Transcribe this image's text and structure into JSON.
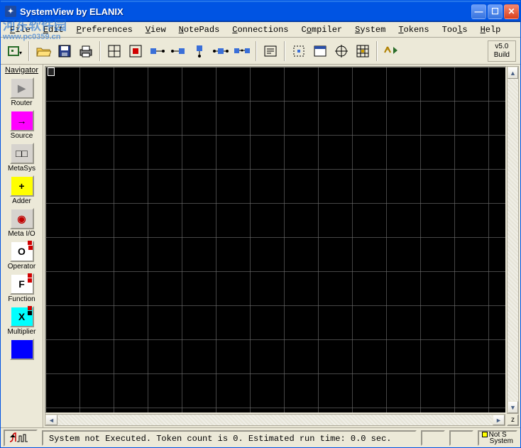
{
  "window": {
    "title": "SystemView by ELANIX"
  },
  "watermark": {
    "text": "河东软件园",
    "url": "www.pc0359.cn"
  },
  "menus": [
    "File",
    "Edit",
    "Preferences",
    "View",
    "NotePads",
    "Connections",
    "Compiler",
    "System",
    "Tokens",
    "Tools",
    "Help"
  ],
  "version": {
    "line1": "v5.0",
    "line2": "Build"
  },
  "navigator": {
    "title": "Navigator",
    "items": [
      {
        "label": "Router",
        "glyph": "▶",
        "bg": "#d6d3ce",
        "fg": "#808080"
      },
      {
        "label": "Source",
        "glyph": "→",
        "bg": "#ff00ff",
        "fg": "#000"
      },
      {
        "label": "MetaSys",
        "glyph": "□□",
        "bg": "#d6d3ce",
        "fg": "#000"
      },
      {
        "label": "Adder",
        "glyph": "+",
        "bg": "#ffff00",
        "fg": "#000"
      },
      {
        "label": "Meta I/O",
        "glyph": "◉",
        "bg": "#d6d3ce",
        "fg": "#c00000"
      },
      {
        "label": "Operator",
        "glyph": "O",
        "bg": "#ffffff",
        "fg": "#000"
      },
      {
        "label": "Function",
        "glyph": "F",
        "bg": "#ffffff",
        "fg": "#000"
      },
      {
        "label": "Multiplier",
        "glyph": "X",
        "bg": "#00ffff",
        "fg": "#000"
      },
      {
        "label": "",
        "glyph": "",
        "bg": "#0000ff",
        "fg": "#fff"
      }
    ]
  },
  "status": {
    "text": "System not Executed.  Token count is 0.   Estimated run time: 0.0 sec.",
    "flag_line1": "Not S",
    "flag_line2": "System"
  },
  "toolbar_icons": [
    "system-menu-icon",
    "open-icon",
    "save-icon",
    "print-icon",
    "grid-toggle-icon",
    "stop-icon",
    "node-left-icon",
    "node-right-icon",
    "node-down-icon",
    "node-both-icon",
    "node-chain-icon",
    "text-box-icon",
    "select-area-icon",
    "window-icon",
    "crosshair-icon",
    "grid-design-icon",
    "run-icon"
  ],
  "status_icon": "cursor-wave-icon",
  "z_button": "z"
}
